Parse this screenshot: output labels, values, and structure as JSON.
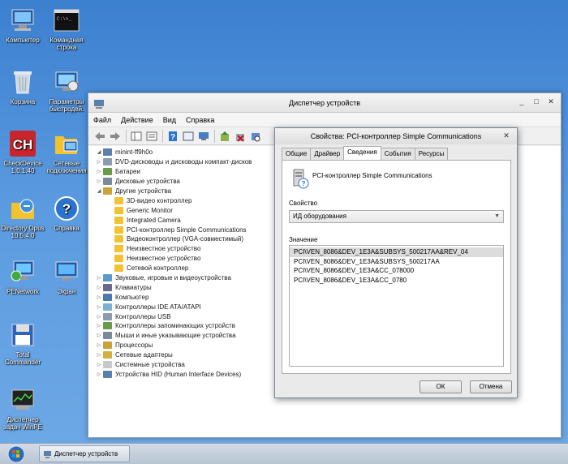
{
  "desktop": {
    "icons": [
      {
        "label": "Компьютер"
      },
      {
        "label": "Командная строка"
      },
      {
        "label": "Корзина"
      },
      {
        "label": "Параметры быстродей."
      },
      {
        "label": "CheckDevice 1.0.1.40"
      },
      {
        "label": "Сетевые подключения"
      },
      {
        "label": "Directory Opus 10.5.4.0"
      },
      {
        "label": "Справка"
      },
      {
        "label": "PENetwork"
      },
      {
        "label": "Экран"
      },
      {
        "label": "Total Commander"
      },
      {
        "label": "Диспетчер задач WinPE"
      }
    ]
  },
  "main_window": {
    "title": "Диспетчер устройств",
    "menu": [
      "Файл",
      "Действие",
      "Вид",
      "Справка"
    ],
    "tree": {
      "root": "minint-ff9h0o",
      "items": [
        {
          "label": "DVD-дисководы и дисководы компакт-дисков",
          "expander": "▷"
        },
        {
          "label": "Батареи",
          "expander": "▷"
        },
        {
          "label": "Дисковые устройства",
          "expander": "▷"
        },
        {
          "label": "Другие устройства",
          "expander": "◢"
        },
        {
          "label": "3D-видео контроллер",
          "child": true
        },
        {
          "label": "Generic Monitor",
          "child": true
        },
        {
          "label": "Integrated Camera",
          "child": true
        },
        {
          "label": "PCI-контроллер Simple Communications",
          "child": true
        },
        {
          "label": "Видеоконтроллер (VGA-совместимый)",
          "child": true
        },
        {
          "label": "Неизвестное устройство",
          "child": true
        },
        {
          "label": "Неизвестное устройство",
          "child": true
        },
        {
          "label": "Сетевой контроллер",
          "child": true
        },
        {
          "label": "Звуковые, игровые и видеоустройства",
          "expander": "▷"
        },
        {
          "label": "Клавиатуры",
          "expander": "▷"
        },
        {
          "label": "Компьютер",
          "expander": "▷"
        },
        {
          "label": "Контроллеры IDE ATA/ATAPI",
          "expander": "▷"
        },
        {
          "label": "Контроллеры USB",
          "expander": "▷"
        },
        {
          "label": "Контроллеры запоминающих устройств",
          "expander": "▷"
        },
        {
          "label": "Мыши и иные указывающие устройства",
          "expander": "▷"
        },
        {
          "label": "Процессоры",
          "expander": "▷"
        },
        {
          "label": "Сетевые адаптеры",
          "expander": "▷"
        },
        {
          "label": "Системные устройства",
          "expander": "▷"
        },
        {
          "label": "Устройства HID (Human Interface Devices)",
          "expander": "▷"
        }
      ]
    }
  },
  "dialog": {
    "title": "Свойства: PCI-контроллер Simple Communications",
    "tabs": [
      "Общие",
      "Драйвер",
      "Сведения",
      "События",
      "Ресурсы"
    ],
    "active_tab": "Сведения",
    "device_name": "PCI-контроллер Simple Communications",
    "property_label": "Свойство",
    "property_value": "ИД оборудования",
    "value_label": "Значение",
    "values": [
      "PCI\\VEN_8086&DEV_1E3A&SUBSYS_500217AA&REV_04",
      "PCI\\VEN_8086&DEV_1E3A&SUBSYS_500217AA",
      "PCI\\VEN_8086&DEV_1E3A&CC_078000",
      "PCI\\VEN_8086&DEV_1E3A&CC_0780"
    ],
    "ok_label": "ОК",
    "cancel_label": "Отмена"
  },
  "taskbar": {
    "item_label": "Диспетчер устройств"
  },
  "colors": {
    "desktop": "#5b9be0",
    "selection": "#dcdcdc",
    "warning": "#f2c230"
  }
}
